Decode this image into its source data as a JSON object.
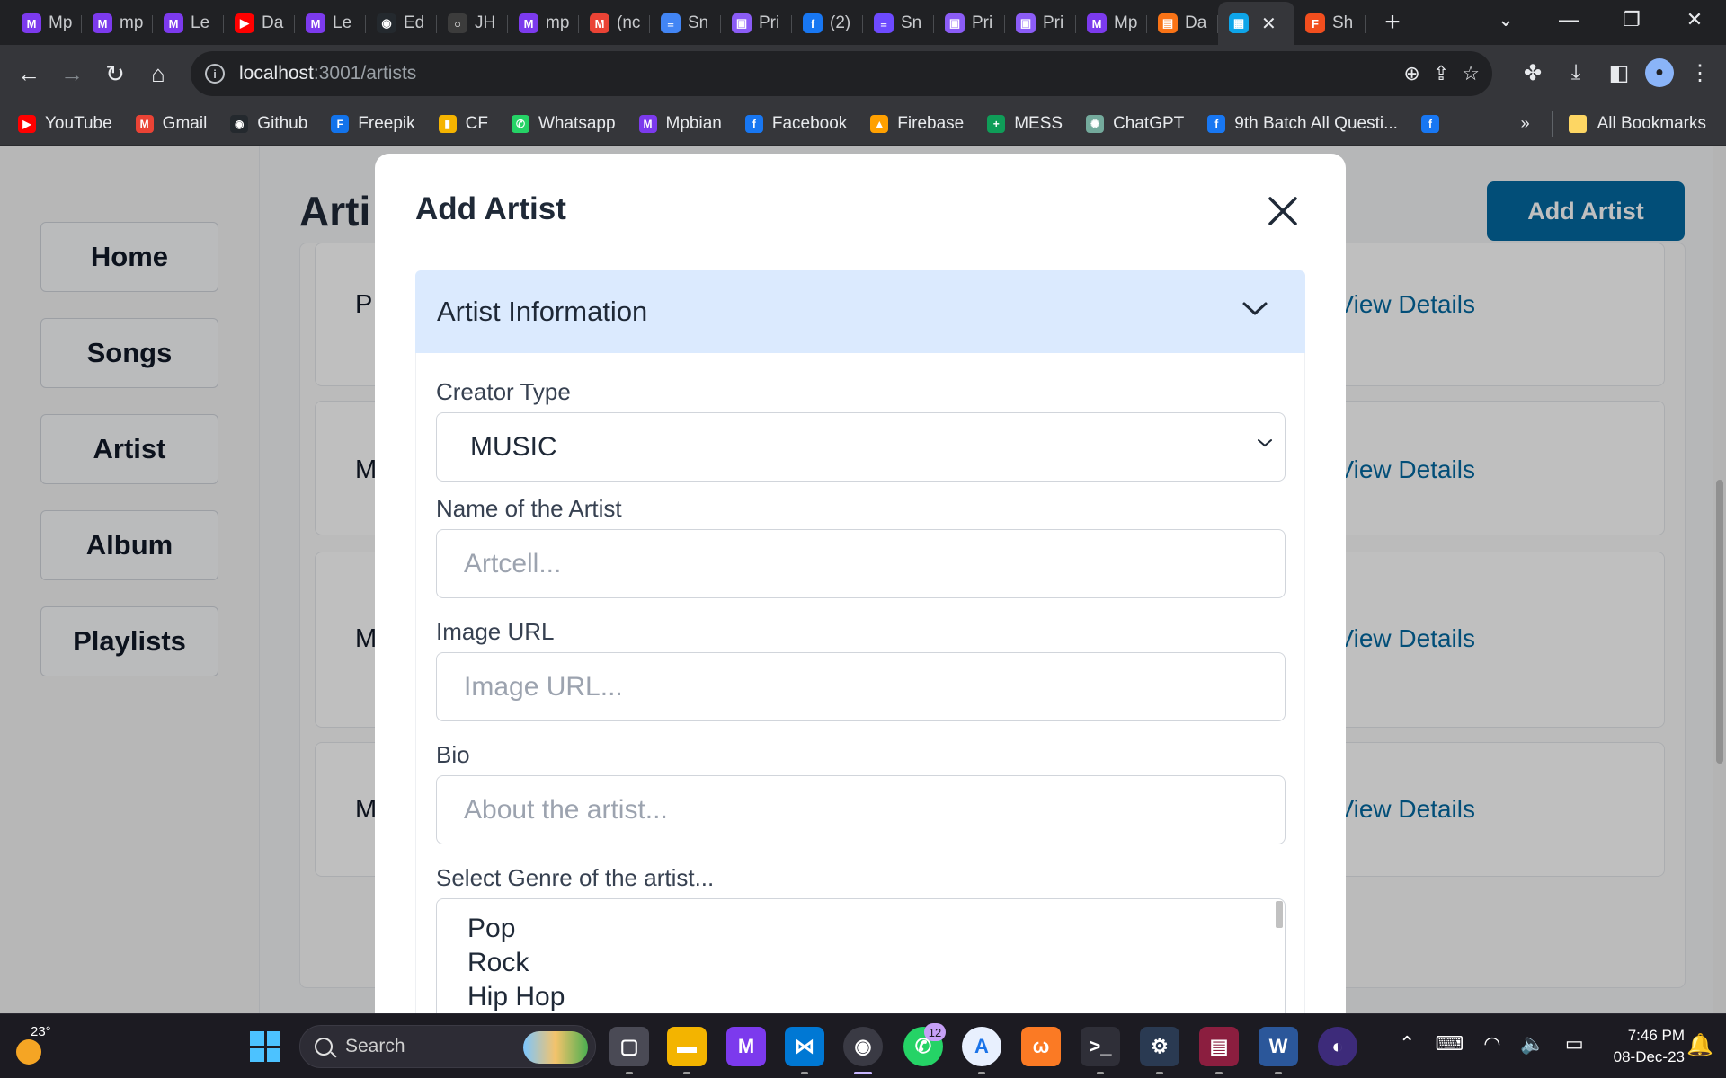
{
  "browser": {
    "tabs": [
      {
        "label": "Mp",
        "favicon": "M",
        "color": "#7c3aed"
      },
      {
        "label": "mp",
        "favicon": "M",
        "color": "#7c3aed"
      },
      {
        "label": "Le",
        "favicon": "M",
        "color": "#7c3aed"
      },
      {
        "label": "Da",
        "favicon": "▶",
        "color": "#ff0000"
      },
      {
        "label": "Le",
        "favicon": "M",
        "color": "#7c3aed"
      },
      {
        "label": "Ed",
        "favicon": "◉",
        "color": "#24292e"
      },
      {
        "label": "JH",
        "favicon": "○",
        "color": "#3c3c3c"
      },
      {
        "label": "mp",
        "favicon": "M",
        "color": "#7c3aed"
      },
      {
        "label": "(nc",
        "favicon": "M",
        "color": "#ea4335"
      },
      {
        "label": "Sn",
        "favicon": "≡",
        "color": "#4285f4"
      },
      {
        "label": "Pri",
        "favicon": "▣",
        "color": "#8b5cf6"
      },
      {
        "label": "(2)",
        "favicon": "f",
        "color": "#1877f2"
      },
      {
        "label": "Sn",
        "favicon": "≡",
        "color": "#6d4aff"
      },
      {
        "label": "Pri",
        "favicon": "▣",
        "color": "#8b5cf6"
      },
      {
        "label": "Pri",
        "favicon": "▣",
        "color": "#8b5cf6"
      },
      {
        "label": "Mp",
        "favicon": "M",
        "color": "#7c3aed"
      },
      {
        "label": "Da",
        "favicon": "▤",
        "color": "#f97316"
      },
      {
        "label": "",
        "favicon": "▦",
        "color": "#0ea5e9",
        "active": true
      },
      {
        "label": "Sh",
        "favicon": "F",
        "color": "#f24e1e"
      }
    ],
    "url_host": "localhost",
    "url_path": ":3001/artists",
    "bookmarks": [
      {
        "label": "YouTube",
        "favicon": "▶",
        "color": "#ff0000"
      },
      {
        "label": "Gmail",
        "favicon": "M",
        "color": "#ea4335"
      },
      {
        "label": "Github",
        "favicon": "◉",
        "color": "#24292e"
      },
      {
        "label": "Freepik",
        "favicon": "F",
        "color": "#1273eb"
      },
      {
        "label": "CF",
        "favicon": "▮",
        "color": "#f5b400"
      },
      {
        "label": "Whatsapp",
        "favicon": "✆",
        "color": "#25d366"
      },
      {
        "label": "Mpbian",
        "favicon": "M",
        "color": "#7c3aed"
      },
      {
        "label": "Facebook",
        "favicon": "f",
        "color": "#1877f2"
      },
      {
        "label": "Firebase",
        "favicon": "▲",
        "color": "#ffa000"
      },
      {
        "label": "MESS",
        "favicon": "+",
        "color": "#0f9d58"
      },
      {
        "label": "ChatGPT",
        "favicon": "✺",
        "color": "#74aa9c"
      },
      {
        "label": "9th Batch All Questi...",
        "favicon": "f",
        "color": "#1877f2"
      },
      {
        "label": "",
        "favicon": "f",
        "color": "#1877f2"
      }
    ],
    "bookmarks_overflow": "»",
    "all_bookmarks": "All Bookmarks"
  },
  "app": {
    "nav": [
      "Home",
      "Songs",
      "Artist",
      "Album",
      "Playlists"
    ],
    "page_title": "Arti",
    "add_button": "Add Artist",
    "cards": [
      {
        "initial": "P",
        "link": "View Details"
      },
      {
        "initial": "M",
        "link": "View Details"
      },
      {
        "initial": "M",
        "link": "View Details"
      },
      {
        "initial": "M",
        "link": "View Details"
      }
    ]
  },
  "modal": {
    "title": "Add Artist",
    "section": "Artist Information",
    "creator_type_label": "Creator Type",
    "creator_type_value": "MUSIC",
    "name_label": "Name of the Artist",
    "name_placeholder": "Artcell...",
    "image_label": "Image URL",
    "image_placeholder": "Image URL...",
    "bio_label": "Bio",
    "bio_placeholder": "About the artist...",
    "genre_label": "Select Genre of the artist...",
    "genres": [
      "Pop",
      "Rock",
      "Hip Hop"
    ]
  },
  "taskbar": {
    "temperature": "23°",
    "search_label": "Search",
    "whatsapp_badge": "12",
    "time": "7:46 PM",
    "date": "08-Dec-23"
  },
  "colors": {
    "accent": "#0369a1",
    "accordion_bg": "#dbeafe",
    "overlay": "rgba(0,0,0,0.25)"
  }
}
